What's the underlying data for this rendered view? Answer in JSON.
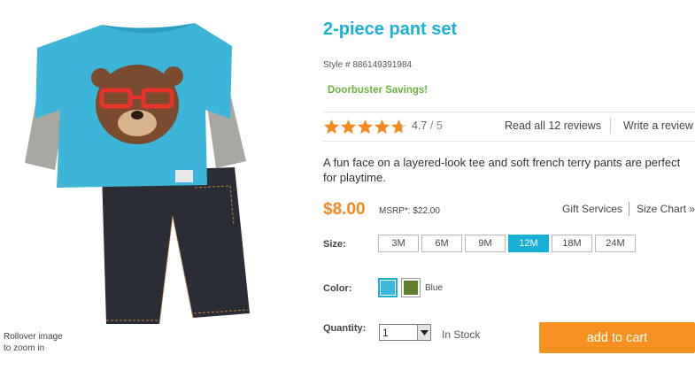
{
  "product": {
    "title": "2-piece pant set",
    "style_label": "Style # 886149391984",
    "promo": "Doorbuster Savings!",
    "description": "A fun face on a layered-look tee and soft french terry pants are perfect for playtime."
  },
  "image": {
    "zoom_hint_line1": "Rollover image",
    "zoom_hint_line2": "to zoom in"
  },
  "rating": {
    "stars": 4.7,
    "score": "4.7",
    "out_of": "/ 5",
    "read_reviews": "Read all 12 reviews",
    "write_review": "Write a review",
    "star_color": "#f5881f"
  },
  "pricing": {
    "price": "$8.00",
    "msrp": "MSRP*: $22.00",
    "gift_services": "Gift Services",
    "size_chart": "Size Chart »"
  },
  "size": {
    "label": "Size:",
    "options": [
      "3M",
      "6M",
      "9M",
      "12M",
      "18M",
      "24M"
    ],
    "selected": "12M"
  },
  "color": {
    "label": "Color:",
    "swatches": [
      {
        "name": "blue-swatch",
        "hex": "#3bb8dc",
        "selected": true
      },
      {
        "name": "green-swatch",
        "hex": "#5f7f2c",
        "selected": false
      }
    ],
    "selected_name": "Blue"
  },
  "quantity": {
    "label": "Quantity:",
    "value": "1",
    "stock": "In Stock"
  },
  "cart": {
    "button_label": "add to cart"
  },
  "colors": {
    "accent_blue": "#1ab0d8",
    "price_orange": "#f5881f",
    "promo_green": "#6cb33e",
    "cart_orange": "#f7901e"
  }
}
